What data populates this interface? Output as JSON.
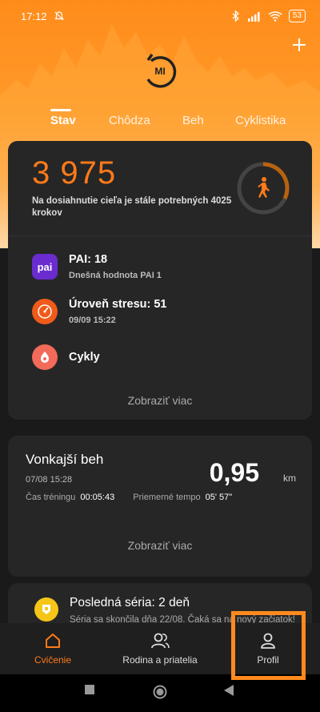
{
  "status_bar": {
    "time": "17:12",
    "battery": "53"
  },
  "tabs": [
    {
      "label": "Stav"
    },
    {
      "label": "Chôdza"
    },
    {
      "label": "Beh"
    },
    {
      "label": "Cyklistika"
    }
  ],
  "steps_card": {
    "steps_value": "3 975",
    "steps_desc": "Na dosiahnutie cieľa je stále potrebných 4025 krokov",
    "pai": {
      "badge": "pai",
      "title": "PAI: 18",
      "subtitle": "Dnešná hodnota PAI 1"
    },
    "stress": {
      "title": "Úroveň stresu: 51",
      "subtitle": "09/09 15:22"
    },
    "cycles": {
      "title": "Cykly"
    },
    "more_label": "Zobraziť viac"
  },
  "run_card": {
    "title": "Vonkajší beh",
    "date": "07/08 15:28",
    "distance": "0,95",
    "unit": "km",
    "training_time_label": "Čas tréningu",
    "training_time_value": "00:05:43",
    "pace_label": "Priemerné tempo",
    "pace_value": "05' 57\"",
    "more_label": "Zobraziť viac"
  },
  "series_card": {
    "title": "Posledná séria: 2 deň",
    "subtitle": "Séria sa skončila dňa 22/08. Čaká sa na nový začiatok!"
  },
  "bottom_nav": [
    {
      "label": "Cvičenie"
    },
    {
      "label": "Rodina a priatelia"
    },
    {
      "label": "Profil"
    }
  ],
  "colors": {
    "accent": "#ff7a1a",
    "card_bg": "#262626",
    "highlight": "#ff8a1e"
  }
}
